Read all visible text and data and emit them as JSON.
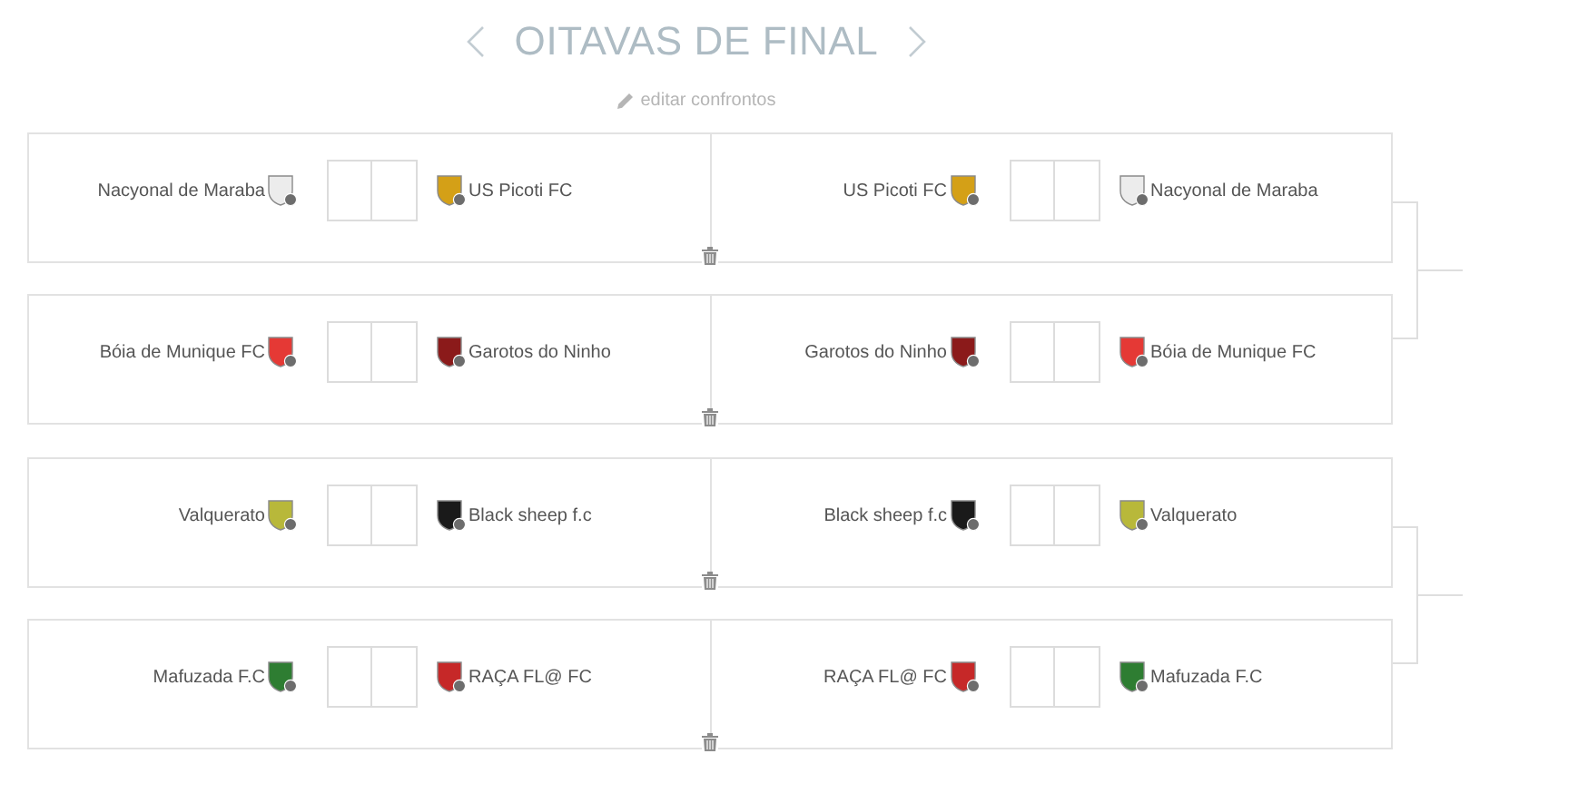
{
  "header": {
    "title": "OITAVAS DE FINAL",
    "edit_link": "editar confrontos"
  },
  "matches": [
    {
      "legs": [
        {
          "home": {
            "name": "Nacyonal de Maraba",
            "color": "#ececec"
          },
          "away": {
            "name": "US Picoti FC",
            "color": "#d4a017"
          }
        },
        {
          "home": {
            "name": "US Picoti FC",
            "color": "#d4a017"
          },
          "away": {
            "name": "Nacyonal de Maraba",
            "color": "#ececec"
          }
        }
      ]
    },
    {
      "legs": [
        {
          "home": {
            "name": "Bóia de Munique FC",
            "color": "#e53935"
          },
          "away": {
            "name": "Garotos do Ninho",
            "color": "#8b1a1a"
          }
        },
        {
          "home": {
            "name": "Garotos do Ninho",
            "color": "#8b1a1a"
          },
          "away": {
            "name": "Bóia de Munique FC",
            "color": "#e53935"
          }
        }
      ]
    },
    {
      "legs": [
        {
          "home": {
            "name": "Valquerato",
            "color": "#b8b83a"
          },
          "away": {
            "name": "Black sheep f.c",
            "color": "#1a1a1a"
          }
        },
        {
          "home": {
            "name": "Black sheep f.c",
            "color": "#1a1a1a"
          },
          "away": {
            "name": "Valquerato",
            "color": "#b8b83a"
          }
        }
      ]
    },
    {
      "legs": [
        {
          "home": {
            "name": "Mafuzada F.C",
            "color": "#2e7d32"
          },
          "away": {
            "name": "RAÇA FL@ FC",
            "color": "#c62828"
          }
        },
        {
          "home": {
            "name": "RAÇA FL@ FC",
            "color": "#c62828"
          },
          "away": {
            "name": "Mafuzada F.C",
            "color": "#2e7d32"
          }
        }
      ]
    }
  ]
}
